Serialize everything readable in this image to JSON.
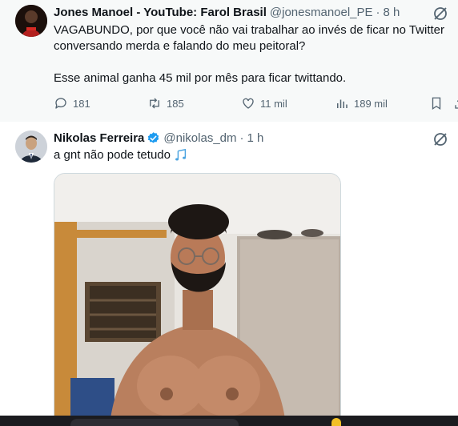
{
  "tweet1": {
    "name": "Jones Manoel - YouTube: Farol Brasil",
    "handle": "@jonesmanoel_PE",
    "dot": "·",
    "time": "8 h",
    "text_line1": "VAGABUNDO, por que você não vai trabalhar ao invés de ficar no Twitter conversando merda e falando do meu peitoral?",
    "text_line2": "Esse animal ganha 45 mil por mês para ficar twittando.",
    "replies": "181",
    "retweets": "185",
    "likes": "11 mil",
    "views": "189 mil"
  },
  "tweet2": {
    "name": "Nikolas Ferreira",
    "handle": "@nikolas_dm",
    "dot": "·",
    "time": "1 h",
    "text": "a gnt não pode tetudo",
    "emoji_icon": "musical-notes-icon",
    "verified_color": "#1d9bf0"
  },
  "colors": {
    "secondary_text": "#536471",
    "thread_line": "#cfd9de",
    "highlight_bg": "#f7f9f9"
  }
}
